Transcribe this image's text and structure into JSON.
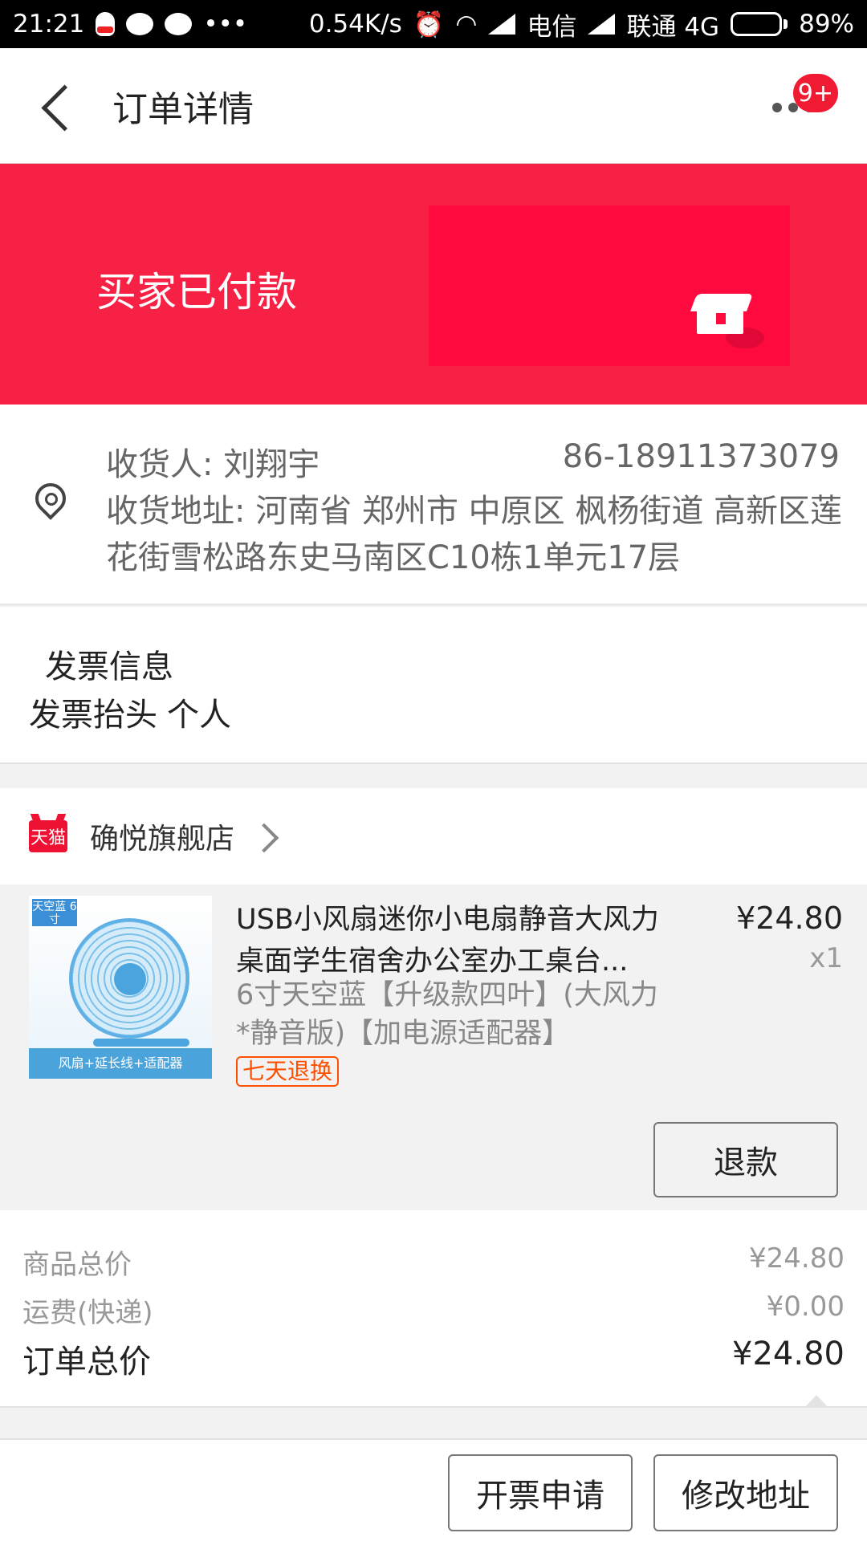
{
  "status_bar": {
    "time": "21:21",
    "more": "•••",
    "speed": "0.54K/s",
    "carrier1": "电信",
    "carrier2": "联通 4G",
    "battery": "89%",
    "battery_level": 0.89
  },
  "nav": {
    "title": "订单详情",
    "badge": "9+"
  },
  "banner": {
    "status_text": "买家已付款",
    "color": "#f72045"
  },
  "receiver": {
    "name_label": "收货人: 刘翔宇",
    "phone": "86-18911373079",
    "address": "收货地址: 河南省 郑州市 中原区 枫杨街道 高新区莲花街雪松路东史马南区C10栋1单元17层"
  },
  "invoice": {
    "title": "发票信息",
    "header_label": "发票抬头",
    "header_value": "个人"
  },
  "shop": {
    "logo_text": "天猫",
    "name": "确悦旗舰店"
  },
  "product": {
    "image": {
      "tag": "天空蓝 6寸",
      "strip": "风扇+延长线+适配器"
    },
    "title": "USB小风扇迷你小电扇静音大风力桌面学生宿舍办公室办工桌台...",
    "sku": "6寸天空蓝【升级款四叶】(大风力*静音版)【加电源适配器】",
    "price": "¥24.80",
    "qty": "x1",
    "service_badge": "七天退换",
    "refund_label": "退款"
  },
  "summary": {
    "goods_total_label": "商品总价",
    "goods_total_value": "¥24.80",
    "shipping_label": "运费(快递)",
    "shipping_value": "¥0.00",
    "order_total_label": "订单总价",
    "order_total_value": "¥24.80"
  },
  "actions": {
    "invoice_apply": "开票申请",
    "modify_address": "修改地址"
  },
  "colors": {
    "accent": "#f01a32",
    "banner": "#f72045",
    "service_badge": "#ff5000"
  }
}
